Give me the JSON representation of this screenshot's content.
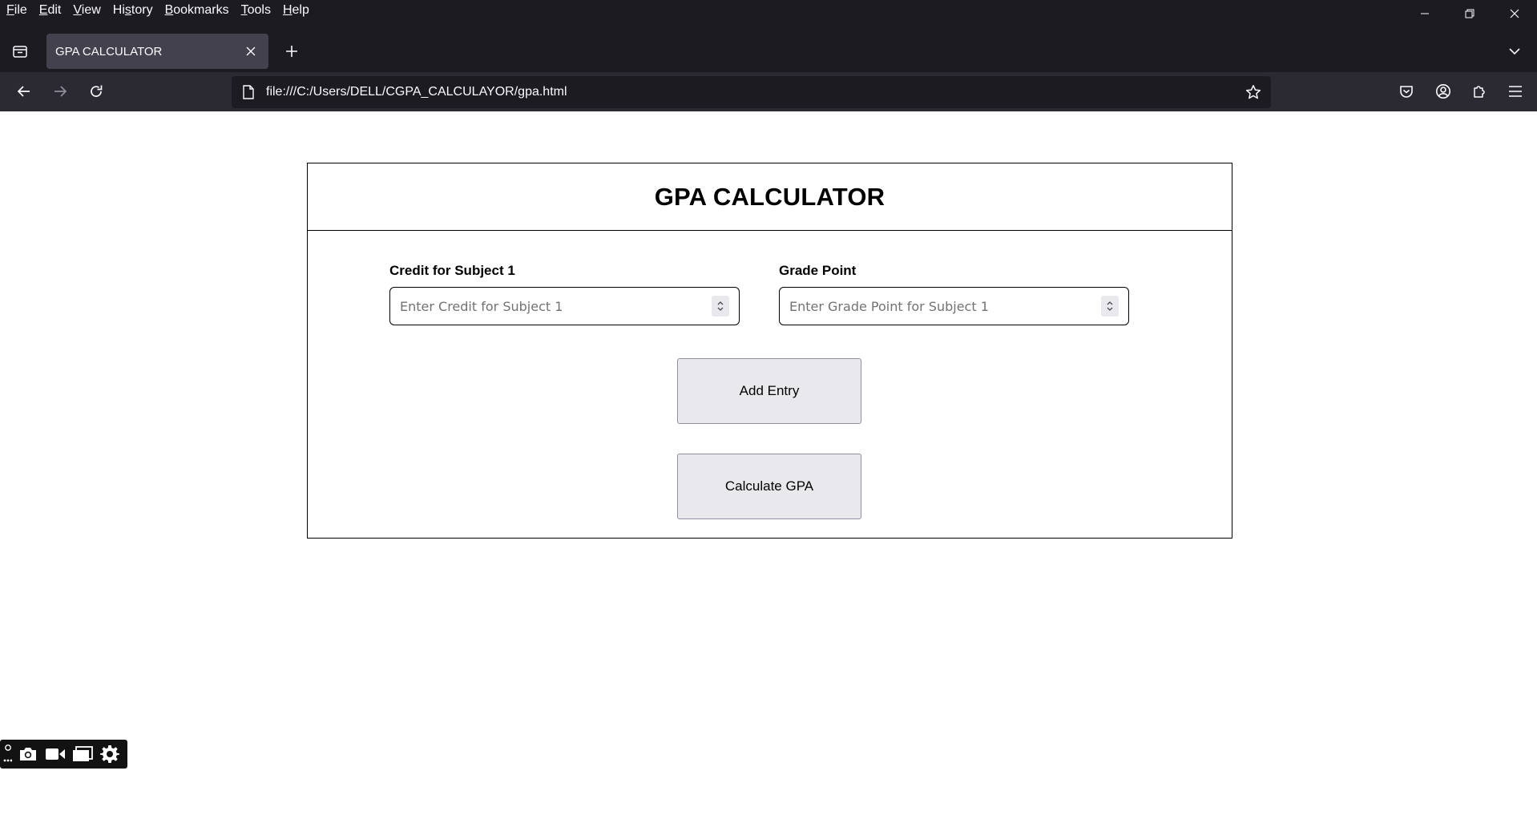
{
  "browser": {
    "menu": [
      {
        "pre": "",
        "mn": "F",
        "post": "ile"
      },
      {
        "pre": "",
        "mn": "E",
        "post": "dit"
      },
      {
        "pre": "",
        "mn": "V",
        "post": "iew"
      },
      {
        "pre": "Hi",
        "mn": "s",
        "post": "tory"
      },
      {
        "pre": "",
        "mn": "B",
        "post": "ookmarks"
      },
      {
        "pre": "",
        "mn": "T",
        "post": "ools"
      },
      {
        "pre": "",
        "mn": "H",
        "post": "elp"
      }
    ],
    "tab_title": "GPA CALCULATOR",
    "url": "file:///C:/Users/DELL/CGPA_CALCULAYOR/gpa.html"
  },
  "page": {
    "title": "GPA CALCULATOR",
    "credit_label": "Credit for Subject 1",
    "credit_placeholder": "Enter Credit for Subject 1",
    "grade_label": "Grade Point",
    "grade_placeholder": "Enter Grade Point for Subject 1",
    "add_entry_label": "Add Entry",
    "calculate_label": "Calculate GPA"
  },
  "icons": {
    "colors": {
      "chrome_bg": "#1c1b22",
      "toolbar_bg": "#2b2a33",
      "tab_active": "#42414d",
      "button_bg": "#e9e9ed"
    }
  }
}
